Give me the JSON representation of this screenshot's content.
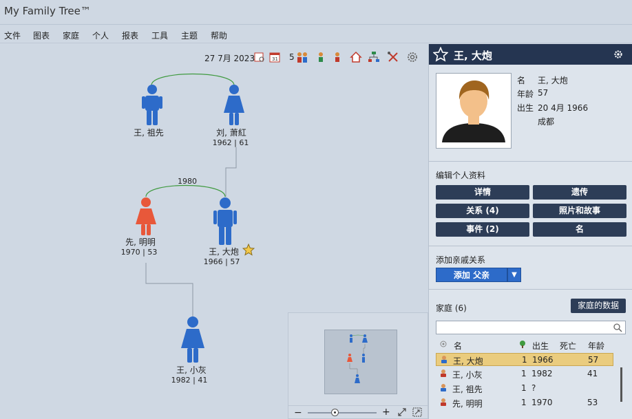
{
  "app": {
    "title": "My Family Tree™"
  },
  "menu": [
    "文件",
    "图表",
    "家庭",
    "个人",
    "报表",
    "工具",
    "主题",
    "帮助"
  ],
  "toolbar": {
    "date": "27 7月 2023",
    "generations": "5"
  },
  "tree": {
    "people": [
      {
        "name": "王, 祖先",
        "years": "",
        "gender": "male"
      },
      {
        "name": "刘, 萧紅",
        "years": "1962 | 61",
        "gender": "female"
      },
      {
        "name": "先, 明明",
        "years": "1970 | 53",
        "gender": "female",
        "highlight": true
      },
      {
        "name": "王, 大炮",
        "years": "1966 | 57",
        "gender": "male",
        "starred": true
      },
      {
        "name": "王, 小灰",
        "years": "1982 | 41",
        "gender": "female"
      }
    ],
    "marriage_year": "1980"
  },
  "panel": {
    "name": "王, 大炮",
    "facts": {
      "name_label": "名",
      "name_value": "王, 大炮",
      "age_label": "年龄",
      "age_value": "57",
      "birth_label": "出生",
      "birth_value": "20 4月 1966",
      "birth_place": "成都"
    },
    "edit_title": "编辑个人资料",
    "buttons": [
      "详情",
      "遗传",
      "关系 (4)",
      "照片和故事",
      "事件 (2)",
      "名"
    ],
    "add_title": "添加亲戚关系",
    "add_button": "添加 父亲",
    "family_title": "家庭 (6)",
    "family_data_button": "家庭的数据",
    "search_placeholder": "",
    "columns": {
      "name": "名",
      "born": "出生",
      "died": "死亡",
      "age": "年龄"
    },
    "rows": [
      {
        "name": "王, 大炮",
        "gen": "1",
        "born": "1966",
        "died": "",
        "age": "57",
        "selected": true,
        "gender": "male"
      },
      {
        "name": "王, 小灰",
        "gen": "1",
        "born": "1982",
        "died": "",
        "age": "41",
        "gender": "female"
      },
      {
        "name": "王, 祖先",
        "gen": "1",
        "born": "?",
        "died": "",
        "age": "",
        "gender": "male"
      },
      {
        "name": "先, 明明",
        "gen": "1",
        "born": "1970",
        "died": "",
        "age": "53",
        "gender": "female"
      }
    ]
  },
  "colors": {
    "male": "#2d6bc9",
    "female": "#2d6bc9",
    "highlight": "#e8583a",
    "header": "#253551",
    "button": "#2d3d57",
    "selected_row": "#eacc7e"
  }
}
